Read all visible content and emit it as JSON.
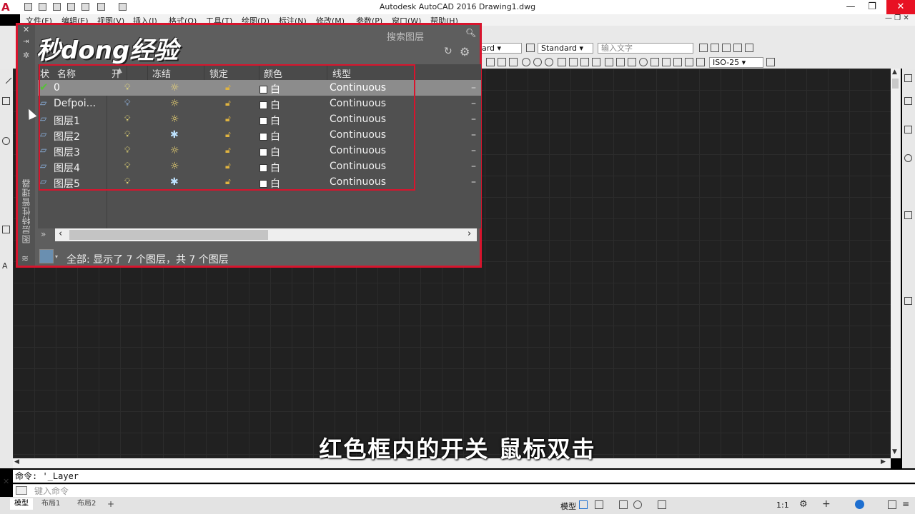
{
  "window": {
    "title": "Autodesk AutoCAD 2016    Drawing1.dwg",
    "minimize": "—",
    "maximize": "❐",
    "close": "✕"
  },
  "menu": [
    "文件(F)",
    "编辑(E)",
    "视图(V)",
    "插入(I)",
    "格式(O)",
    "工具(T)",
    "绘图(D)",
    "标注(N)",
    "修改(M)",
    "参数(P)",
    "窗口(W)",
    "帮助(H)"
  ],
  "toolbar": {
    "style_fragment": "dard",
    "text_style": "Standard",
    "text_input_placeholder": "输入文字",
    "dim_style": "ISO-25"
  },
  "watermark": "秒dong经验",
  "layer_palette": {
    "side_title": "图层特性管理器",
    "search_placeholder": "搜索图层",
    "columns": [
      "状",
      "名称",
      "开",
      "冻结",
      "锁定",
      "颜色",
      "线型"
    ],
    "layers": [
      {
        "name": "0",
        "on": "on",
        "freeze": "thawed",
        "lock": "unlocked",
        "color": "白",
        "linetype": "Continuous",
        "current": true
      },
      {
        "name": "Defpoi...",
        "on": "on",
        "freeze": "thawed",
        "lock": "unlocked",
        "color": "白",
        "linetype": "Continuous",
        "current": false
      },
      {
        "name": "图层1",
        "on": "on",
        "freeze": "thawed",
        "lock": "unlocked",
        "color": "白",
        "linetype": "Continuous",
        "current": false
      },
      {
        "name": "图层2",
        "on": "on",
        "freeze": "frozen",
        "lock": "unlocked",
        "color": "白",
        "linetype": "Continuous",
        "current": false
      },
      {
        "name": "图层3",
        "on": "on",
        "freeze": "thawed",
        "lock": "unlocked",
        "color": "白",
        "linetype": "Continuous",
        "current": false
      },
      {
        "name": "图层4",
        "on": "on",
        "freeze": "thawed",
        "lock": "unlocked",
        "color": "白",
        "linetype": "Continuous",
        "current": false
      },
      {
        "name": "图层5",
        "on": "on",
        "freeze": "frozen",
        "lock": "unlocked",
        "color": "白",
        "linetype": "Continuous",
        "current": false
      }
    ],
    "status_text": "全部: 显示了 7 个图层，共 7 个图层"
  },
  "subtitle": "红色框内的开关 鼠标双击",
  "command": {
    "history": "命令: '_Layer",
    "input_placeholder": "键入命令"
  },
  "status_bar": {
    "tabs": [
      "模型",
      "布局1",
      "布局2"
    ],
    "add_tab": "+",
    "model_label": "模型",
    "scale": "1:1"
  }
}
